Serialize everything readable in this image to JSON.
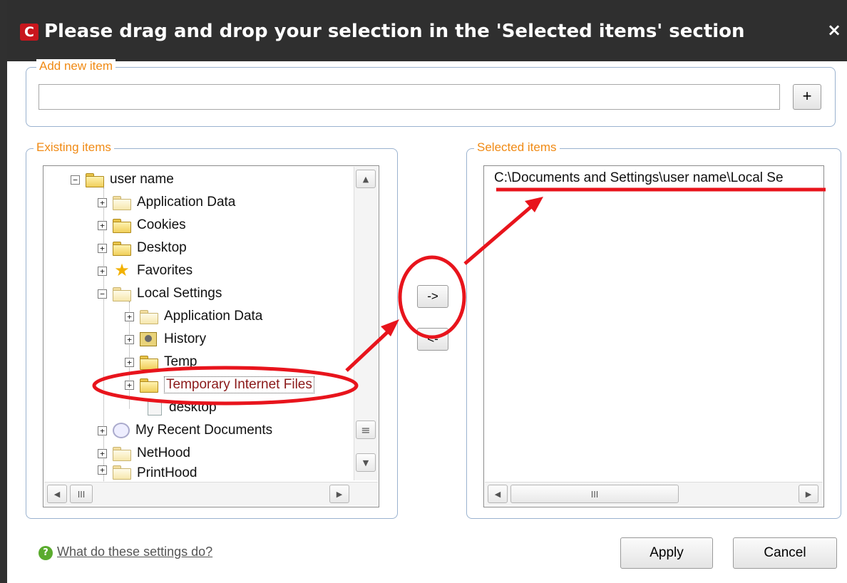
{
  "dialog": {
    "title": "Please drag and drop your selection in the 'Selected items' section",
    "logo_letter": "C",
    "close_glyph": "×"
  },
  "add_new": {
    "legend": "Add new item",
    "input_value": "",
    "add_button": "+"
  },
  "existing": {
    "legend": "Existing items",
    "tree": [
      {
        "label": "user name",
        "expander": "−",
        "icon": "folder-open-icon"
      },
      {
        "label": "Application Data",
        "expander": "+",
        "icon": "folder-icon"
      },
      {
        "label": "Cookies",
        "expander": "+",
        "icon": "folder-icon"
      },
      {
        "label": "Desktop",
        "expander": "+",
        "icon": "folder-icon"
      },
      {
        "label": "Favorites",
        "expander": "+",
        "icon": "star-icon"
      },
      {
        "label": "Local Settings",
        "expander": "−",
        "icon": "folder-open-icon"
      },
      {
        "label": "Application Data",
        "expander": "+",
        "icon": "folder-icon"
      },
      {
        "label": "History",
        "expander": "+",
        "icon": "history-icon"
      },
      {
        "label": "Temp",
        "expander": "+",
        "icon": "folder-icon"
      },
      {
        "label": "Temporary Internet Files",
        "expander": "+",
        "icon": "folder-icon"
      },
      {
        "label": "desktop",
        "expander": "",
        "icon": "file-icon"
      },
      {
        "label": "My Recent Documents",
        "expander": "+",
        "icon": "recent-icon"
      },
      {
        "label": "NetHood",
        "expander": "+",
        "icon": "folder-icon"
      },
      {
        "label": "PrintHood",
        "expander": "+",
        "icon": "folder-icon"
      }
    ],
    "hscroll_thumb_glyph": "III",
    "vscroll_thumb_glyph": "≡"
  },
  "move_buttons": {
    "add": "->",
    "remove": "<-"
  },
  "selected": {
    "legend": "Selected items",
    "items": [
      "C:\\Documents and Settings\\user name\\Local Se"
    ],
    "hscroll_thumb_glyph": "III"
  },
  "footer": {
    "help_link": "What do these settings do?",
    "help_icon_glyph": "?",
    "apply_button": "Apply",
    "cancel_button": "Cancel"
  },
  "colors": {
    "titlebar": "#2f2f2f",
    "legend": "#f08a14",
    "annotation": "#e8141c",
    "selected_item_text": "#8b1a1a"
  }
}
